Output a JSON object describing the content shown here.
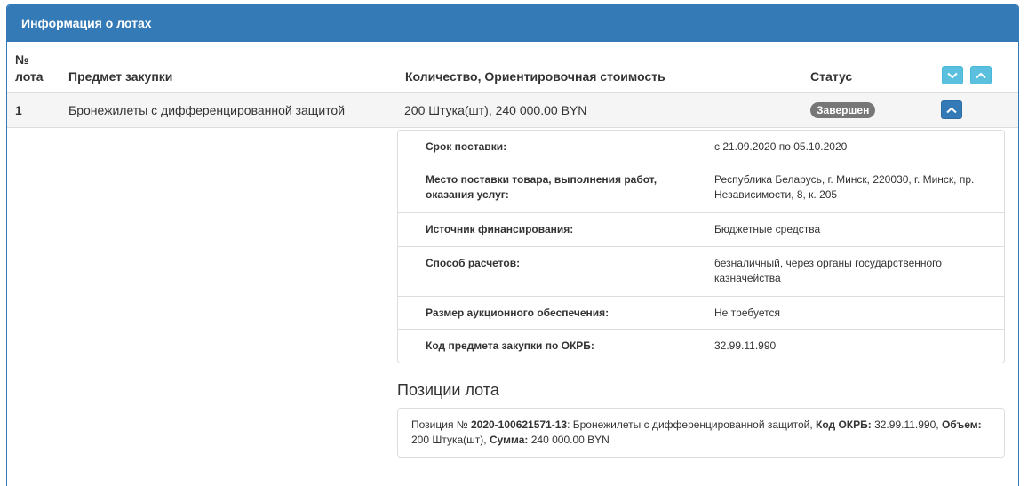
{
  "panel": {
    "title": "Информация о лотах"
  },
  "table": {
    "headers": {
      "num_line1": "№",
      "num_line2": "лота",
      "subject": "Предмет закупки",
      "qty": "Количество, Ориентировочная стоимость",
      "status": "Статус"
    },
    "rows": [
      {
        "num": "1",
        "subject": "Бронежилеты с дифференцированной защитой",
        "qty": "200 Штука(шт), 240 000.00 BYN",
        "status": "Завершен"
      }
    ]
  },
  "details": [
    {
      "label": "Срок поставки:",
      "value": "с 21.09.2020 по 05.10.2020"
    },
    {
      "label": "Место поставки товара, выполнения работ, оказания услуг:",
      "value": "Республика Беларусь, г. Минск, 220030, г. Минск, пр. Независимости, 8, к. 205"
    },
    {
      "label": "Источник финансирования:",
      "value": "Бюджетные средства"
    },
    {
      "label": "Способ расчетов:",
      "value": "безналичный, через органы государственного казначейства"
    },
    {
      "label": "Размер аукционного обеспечения:",
      "value": "Не требуется"
    },
    {
      "label": "Код предмета закупки по ОКРБ:",
      "value": "32.99.11.990"
    }
  ],
  "positions": {
    "title": "Позиции лота",
    "prefix": "Позиция № ",
    "number": "2020-100621571-13",
    "text1": ": Бронежилеты с дифференцированной защитой, ",
    "okrb_label": "Код ОКРБ:",
    "okrb_value": " 32.99.11.990, ",
    "volume_label": "Объем:",
    "volume_value": " 200 Штука(шт), ",
    "sum_label": "Сумма:",
    "sum_value": " 240 000.00 BYN"
  },
  "colors": {
    "primary": "#337ab7",
    "info": "#5bc0de",
    "badge": "#777777"
  },
  "icons": {
    "expand_all": "chevron-down-icon",
    "collapse_all": "chevron-up-icon",
    "row_toggle": "chevron-up-icon"
  }
}
